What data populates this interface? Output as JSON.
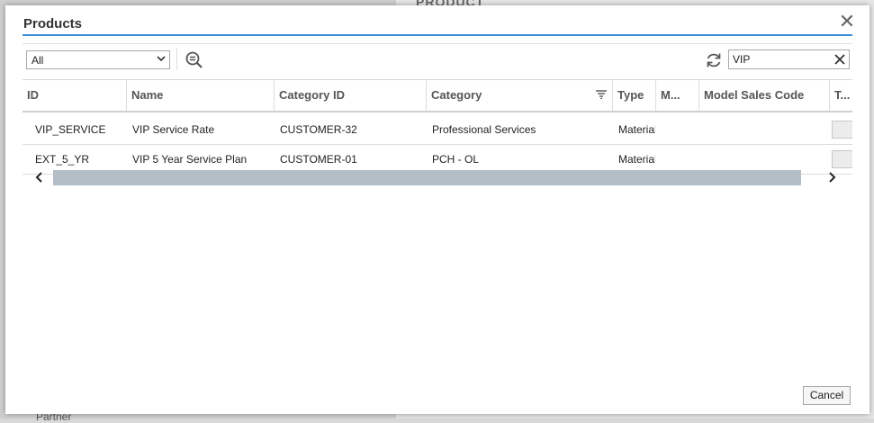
{
  "background": {
    "section_title": "PRODUCT",
    "partner_label": "Partner"
  },
  "dialog": {
    "title": "Products",
    "close_label": "✕"
  },
  "toolbar": {
    "filter_value": "All",
    "filter_options": [
      "All"
    ],
    "search_value": "VIP"
  },
  "table": {
    "columns": [
      {
        "key": "id",
        "label": "ID"
      },
      {
        "key": "name",
        "label": "Name"
      },
      {
        "key": "category_id",
        "label": "Category ID"
      },
      {
        "key": "category",
        "label": "Category"
      },
      {
        "key": "type",
        "label": "Type"
      },
      {
        "key": "m",
        "label": "M..."
      },
      {
        "key": "model_sales_code",
        "label": "Model Sales Code"
      },
      {
        "key": "t",
        "label": "T..."
      }
    ],
    "rows": [
      {
        "id": "VIP_SERVICE",
        "name": "VIP Service Rate",
        "category_id": "CUSTOMER-32",
        "category": "Professional Services",
        "type": "Material",
        "m": "",
        "model_sales_code": ""
      },
      {
        "id": "EXT_5_YR",
        "name": "VIP 5 Year Service Plan",
        "category_id": "CUSTOMER-01",
        "category": "PCH - OL",
        "type": "Material",
        "m": "",
        "model_sales_code": ""
      }
    ]
  },
  "footer": {
    "cancel_label": "Cancel"
  },
  "colors": {
    "accent": "#3d8fd6",
    "scroll_thumb": "#b4bec7"
  }
}
